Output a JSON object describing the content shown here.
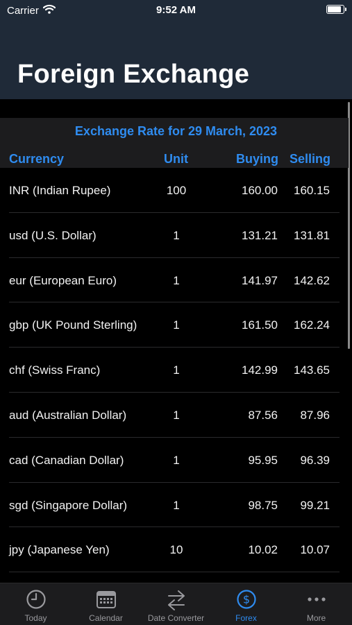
{
  "status": {
    "carrier": "Carrier",
    "time": "9:52 AM",
    "battery_level": 1.0
  },
  "page": {
    "title": "Foreign Exchange"
  },
  "table": {
    "title": "Exchange Rate for 29 March, 2023",
    "headers": {
      "currency": "Currency",
      "unit": "Unit",
      "buying": "Buying",
      "selling": "Selling"
    },
    "rows": [
      {
        "currency": "INR (Indian Rupee)",
        "unit": "100",
        "buying": "160.00",
        "selling": "160.15"
      },
      {
        "currency": "usd (U.S. Dollar)",
        "unit": "1",
        "buying": "131.21",
        "selling": "131.81"
      },
      {
        "currency": "eur (European Euro)",
        "unit": "1",
        "buying": "141.97",
        "selling": "142.62"
      },
      {
        "currency": "gbp (UK Pound Sterling)",
        "unit": "1",
        "buying": "161.50",
        "selling": "162.24"
      },
      {
        "currency": "chf (Swiss Franc)",
        "unit": "1",
        "buying": "142.99",
        "selling": "143.65"
      },
      {
        "currency": "aud (Australian Dollar)",
        "unit": "1",
        "buying": "87.56",
        "selling": "87.96"
      },
      {
        "currency": "cad (Canadian Dollar)",
        "unit": "1",
        "buying": "95.95",
        "selling": "96.39"
      },
      {
        "currency": "sgd (Singapore Dollar)",
        "unit": "1",
        "buying": "98.75",
        "selling": "99.21"
      },
      {
        "currency": "jpy (Japanese Yen)",
        "unit": "10",
        "buying": "10.02",
        "selling": "10.07"
      }
    ]
  },
  "tabs": [
    {
      "label": "Today",
      "icon": "clock-icon"
    },
    {
      "label": "Calendar",
      "icon": "calendar-icon"
    },
    {
      "label": "Date Converter",
      "icon": "arrows-exchange-icon"
    },
    {
      "label": "Forex",
      "icon": "dollar-circle-icon",
      "active": true
    },
    {
      "label": "More",
      "icon": "more-dots-icon"
    }
  ],
  "colors": {
    "accent": "#2f8cf0",
    "header_bg": "#1f2a38",
    "table_header_bg": "#1c1c1e",
    "background": "#000000",
    "inactive_tab": "#9a9a9e"
  }
}
